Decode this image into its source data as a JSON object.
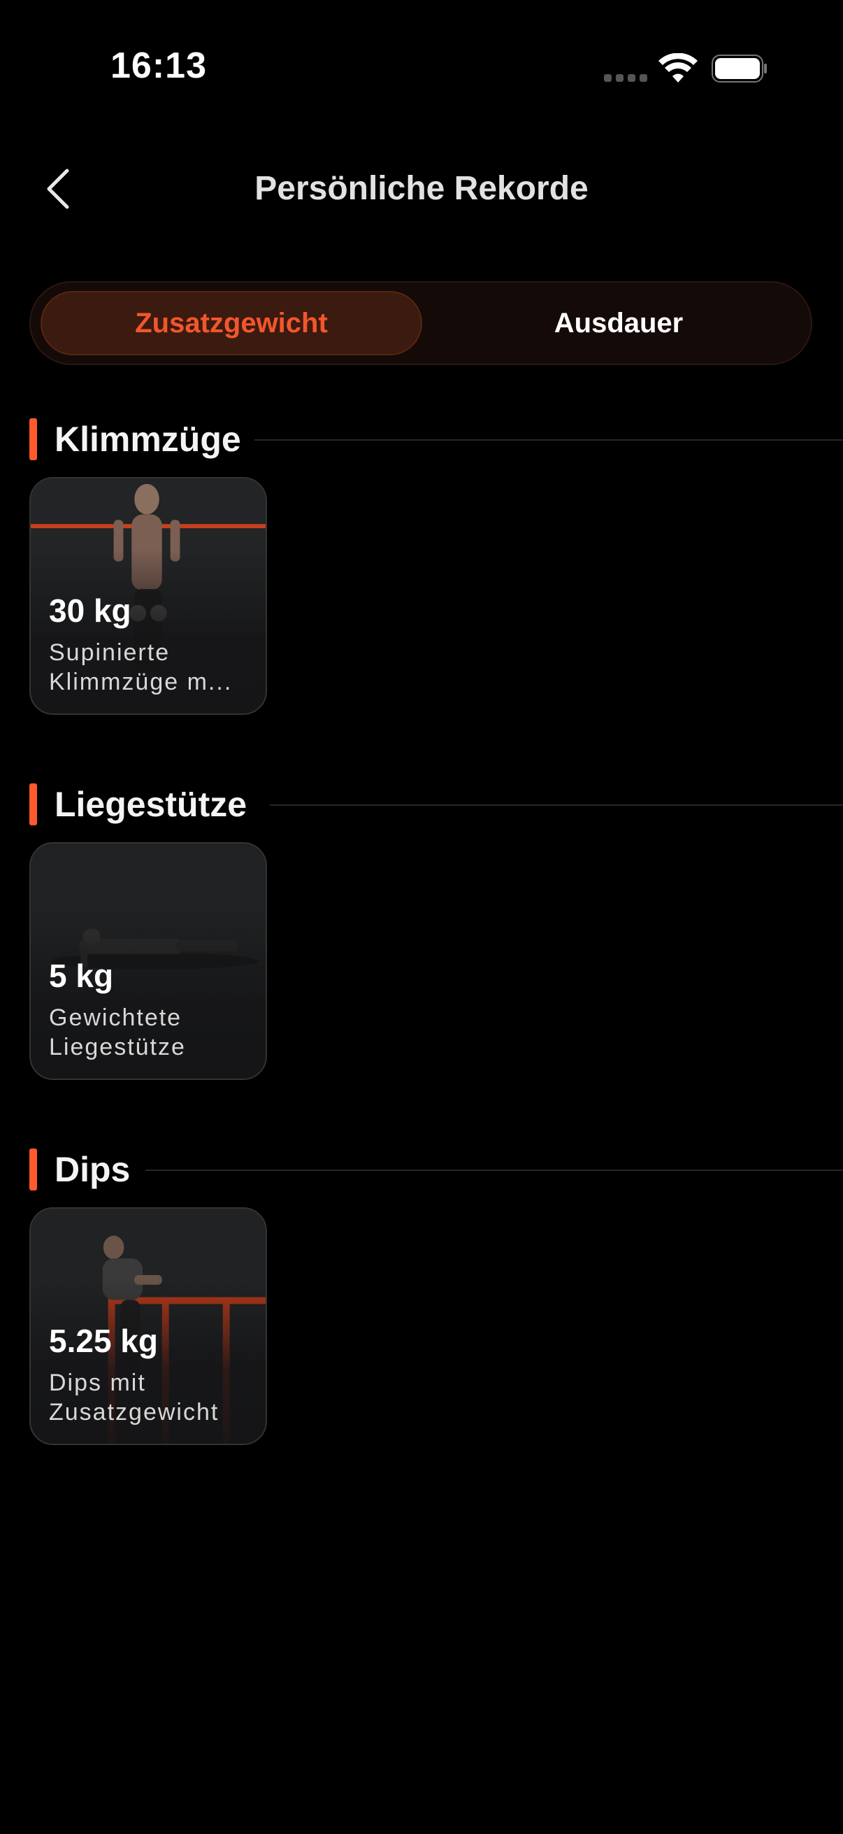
{
  "status_bar": {
    "time": "16:13"
  },
  "header": {
    "title": "Persönliche Rekorde"
  },
  "segments": {
    "active": "Zusatzgewicht",
    "inactive": "Ausdauer"
  },
  "sections": [
    {
      "title": "Klimmzüge",
      "card": {
        "weight": "30 kg",
        "name_line1": "Supinierte",
        "name_line2": "Klimmzüge m..."
      }
    },
    {
      "title": "Liegestütze",
      "card": {
        "weight": "5 kg",
        "name_line1": "Gewichtete",
        "name_line2": "Liegestütze"
      }
    },
    {
      "title": "Dips",
      "card": {
        "weight": "5.25 kg",
        "name_line1": "Dips mit",
        "name_line2": "Zusatzgewicht"
      }
    }
  ],
  "colors": {
    "accent": "#ff5a2d",
    "background": "#000000"
  }
}
